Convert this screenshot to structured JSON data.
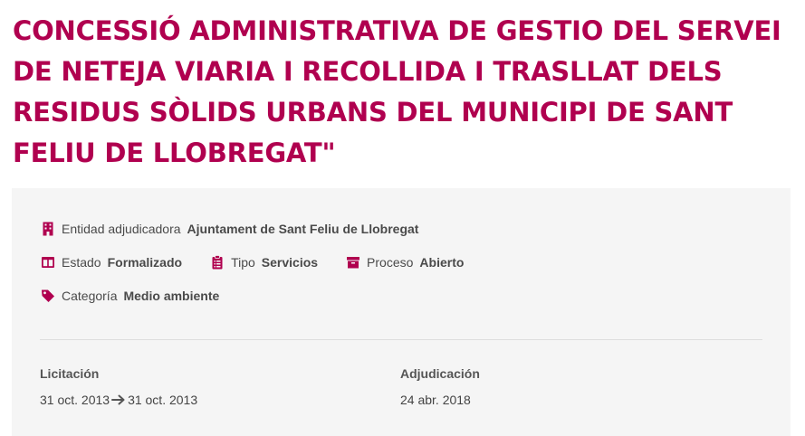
{
  "title": "CONCESSIÓ ADMINISTRATIVA DE GESTIO DEL SERVEI DE NETEJA VIARIA I RECOLLIDA I TRASLLAT DELS RESIDUS SÒLIDS URBANS DEL MUNICIPI DE SANT FELIU DE LLOBREGAT\"",
  "colors": {
    "accent": "#b0004f",
    "card_background": "#f5f5f5"
  },
  "details": {
    "entity": {
      "icon": "building-icon",
      "label": "Entidad adjudicadora",
      "value": "Ajuntament de Sant Feliu de Llobregat"
    },
    "status": {
      "icon": "columns-icon",
      "label": "Estado",
      "value": "Formalizado"
    },
    "type": {
      "icon": "clipboard-icon",
      "label": "Tipo",
      "value": "Servicios"
    },
    "process": {
      "icon": "archive-icon",
      "label": "Proceso",
      "value": "Abierto"
    },
    "category": {
      "icon": "tag-icon",
      "label": "Categoría",
      "value": "Medio ambiente"
    }
  },
  "dates": {
    "tender": {
      "label": "Licitación",
      "start": "31 oct. 2013",
      "arrow_icon": "arrow-right-icon",
      "end": "31 oct. 2013"
    },
    "award": {
      "label": "Adjudicación",
      "date": "24 abr. 2018"
    }
  }
}
